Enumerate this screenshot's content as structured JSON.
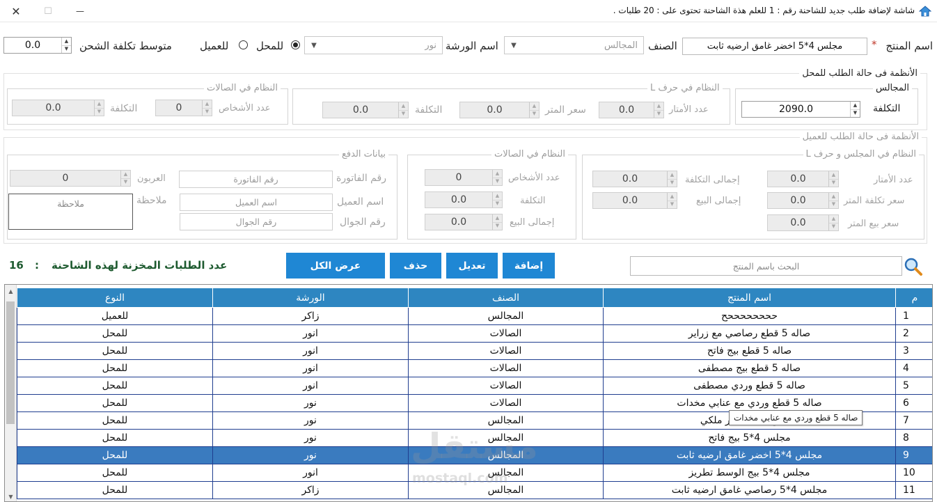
{
  "window": {
    "title": "شاشة لإضافة طلب جديد للشاحنة رقم : 1 للعلم هذة الشاحنة تحتوى على : 20 طلبات .",
    "minimize_label": "—",
    "maximize_label": "☐",
    "close_label": "✕"
  },
  "top_row": {
    "product_label": "اسم المنتج",
    "required_mark": "*",
    "product_value": "مجلس 4*5 اخضر غامق ارضيه ثابت",
    "category_label": "الصنف",
    "category_value": "المجالس",
    "workshop_label": "اسم الورشة",
    "workshop_value": "نور",
    "radio_store_label": "للمحل",
    "radio_customer_label": "للعميل",
    "selected_radio": "store",
    "shipping_label": "متوسط تكلفة الشحن",
    "shipping_value": "0.0"
  },
  "store_systems": {
    "title": "الأنظمة فى حالة الطلب للمحل",
    "majalis": {
      "title": "المجالس",
      "cost_label": "التكلفة",
      "cost_value": "2090.0"
    },
    "l_shape": {
      "title": "النظام في حرف L",
      "meters_label": "عدد الأمتار",
      "meters_value": "0.0",
      "meter_price_label": "سعر المتر",
      "meter_price_value": "0.0",
      "cost_label": "التكلفة",
      "cost_value": "0.0"
    },
    "halls": {
      "title": "النظام في الصالات",
      "persons_label": "عدد الأشخاص",
      "persons_value": "0",
      "cost_label": "التكلفة",
      "cost_value": "0.0"
    }
  },
  "customer_systems": {
    "title": "الأنظمة فى حالة الطلب للعميل",
    "majlis_l": {
      "title": "النظام في المجلس و حرف L",
      "meters_label": "عدد الأمتار",
      "meters_value": "0.0",
      "meter_cost_label": "سعر تكلفة المتر",
      "meter_cost_value": "0.0",
      "meter_sale_label": "سعر بيع المتر",
      "meter_sale_value": "0.0",
      "total_cost_label": "إجمالى التكلفة",
      "total_cost_value": "0.0",
      "total_sale_label": "إجمالى البيع",
      "total_sale_value": "0.0"
    },
    "halls": {
      "title": "النظام في الصالات",
      "persons_label": "عدد الأشخاص",
      "persons_value": "0",
      "cost_label": "التكلفة",
      "cost_value": "0.0",
      "total_sale_label": "إجمالى البيع",
      "total_sale_value": "0.0"
    },
    "payment": {
      "title": "بيانات الدفع",
      "invoice_label": "رقم الفاتورة",
      "invoice_placeholder": "رقم الفاتورة",
      "customer_label": "اسم العميل",
      "customer_placeholder": "اسم العميل",
      "phone_label": "رقم الجوال",
      "phone_placeholder": "رقم الجوال",
      "deposit_label": "العربون",
      "deposit_value": "0",
      "note_label": "ملاحظة",
      "note_placeholder": "ملاحظة"
    }
  },
  "actions": {
    "add": "إضافة",
    "edit": "تعديل",
    "delete": "حذف",
    "show_all": "عرض الكل",
    "search_placeholder": "البحث باسم المنتج",
    "count_label": "عدد الطلبات المخزنة لهذه الشاحنة",
    "count_sep": ":",
    "count_value": "16"
  },
  "grid": {
    "columns": [
      "م",
      "اسم المنتج",
      "الصنف",
      "الورشة",
      "النوع"
    ],
    "rows": [
      [
        "1",
        "ححححححححح",
        "المجالس",
        "زاكر",
        "للعميل"
      ],
      [
        "2",
        "صاله 5 قطع رصاصي مع زراير",
        "الصالات",
        "انور",
        "للمحل"
      ],
      [
        "3",
        "صاله 5 قطع بيج فاتح",
        "الصالات",
        "انور",
        "للمحل"
      ],
      [
        "4",
        "صاله 5 قطع بيج مصطفى",
        "الصالات",
        "انور",
        "للمحل"
      ],
      [
        "5",
        "صاله 5 قطع وردي مصطفى",
        "الصالات",
        "انور",
        "للمحل"
      ],
      [
        "6",
        "صاله 5 قطع وردي مع عنابي مخدات",
        "الصالات",
        "نور",
        "للمحل"
      ],
      [
        "7",
        "مجلس 4*5 اخضر ملكي",
        "المجالس",
        "نور",
        "للمحل"
      ],
      [
        "8",
        "مجلس 4*5 بيج فاتح",
        "المجالس",
        "نور",
        "للمحل"
      ],
      [
        "9",
        "مجلس 4*5 اخضر غامق ارضيه ثابت",
        "المجالس",
        "نور",
        "للمحل"
      ],
      [
        "10",
        "مجلس 4*5 بيج الوسط تطريز",
        "المجالس",
        "انور",
        "للمحل"
      ],
      [
        "11",
        "مجلس 4*5 رصاصي غامق ارضيه ثابت",
        "المجالس",
        "زاكر",
        "للمحل"
      ]
    ],
    "selected_row": 9,
    "tooltip": "صاله 5 قطع وردي مع عنابي مخدات"
  },
  "watermark": {
    "main": "مستقل",
    "sub": "mostaql.com"
  }
}
